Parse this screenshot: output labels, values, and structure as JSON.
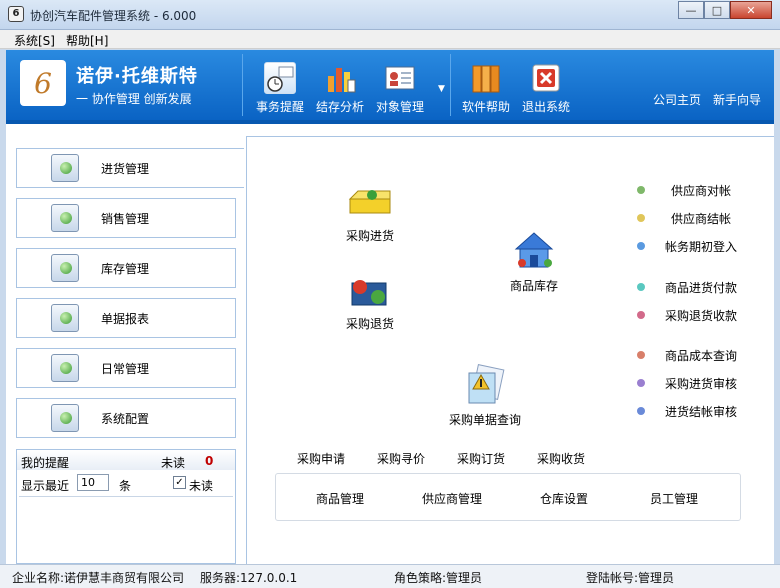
{
  "window": {
    "title": "协创汽车配件管理系统 - 6.000",
    "app_icon": "6"
  },
  "menu": {
    "items": [
      {
        "label": "系统[S]"
      },
      {
        "label": "帮助[H]"
      }
    ]
  },
  "header": {
    "brand": "诺伊·托维斯特",
    "slogan": "一 协作管理 创新发展",
    "tools": [
      {
        "label": "事务提醒",
        "icon": "clock-icon"
      },
      {
        "label": "结存分析",
        "icon": "chart-icon"
      },
      {
        "label": "对象管理",
        "icon": "id-card-icon"
      },
      {
        "label": "软件帮助",
        "icon": "books-icon"
      },
      {
        "label": "退出系统",
        "icon": "exit-icon"
      }
    ],
    "links": [
      {
        "label": "公司主页"
      },
      {
        "label": "新手向导"
      }
    ]
  },
  "nav": {
    "items": [
      {
        "label": "进货管理"
      },
      {
        "label": "销售管理"
      },
      {
        "label": "库存管理"
      },
      {
        "label": "单据报表"
      },
      {
        "label": "日常管理"
      },
      {
        "label": "系统配置"
      }
    ]
  },
  "reminder": {
    "title": "我的提醒",
    "unread_label": "未读",
    "unread_count": "0",
    "recent_label": "显示最近",
    "recent_value": "10",
    "unit": "条",
    "unread_checkbox_label": "未读"
  },
  "panel": {
    "items": [
      {
        "label": "采购进货"
      },
      {
        "label": "采购退货"
      },
      {
        "label": "商品库存"
      },
      {
        "label": "采购单据查询"
      }
    ],
    "links": [
      {
        "label": "供应商对帐",
        "color": "#7fb86a"
      },
      {
        "label": "供应商结帐",
        "color": "#e0c65a"
      },
      {
        "label": "帐务期初登入",
        "color": "#5a9ae0"
      },
      {
        "label": "商品进货付款",
        "color": "#5ac8c0"
      },
      {
        "label": "采购退货收款",
        "color": "#d26a8a"
      },
      {
        "label": "商品成本查询",
        "color": "#d87f6a"
      },
      {
        "label": "采购进货审核",
        "color": "#9a7fd0"
      },
      {
        "label": "进货结帐审核",
        "color": "#6a8ad8"
      }
    ],
    "tabs": [
      {
        "label": "采购申请"
      },
      {
        "label": "采购寻价"
      },
      {
        "label": "采购订货"
      },
      {
        "label": "采购收货"
      }
    ],
    "subitems": [
      {
        "label": "商品管理"
      },
      {
        "label": "供应商管理"
      },
      {
        "label": "仓库设置"
      },
      {
        "label": "员工管理"
      }
    ]
  },
  "status": {
    "company": "企业名称:诺伊慧丰商贸有限公司",
    "server": "服务器:127.0.0.1",
    "role": "角色策略:管理员",
    "account": "登陆帐号:管理员"
  }
}
